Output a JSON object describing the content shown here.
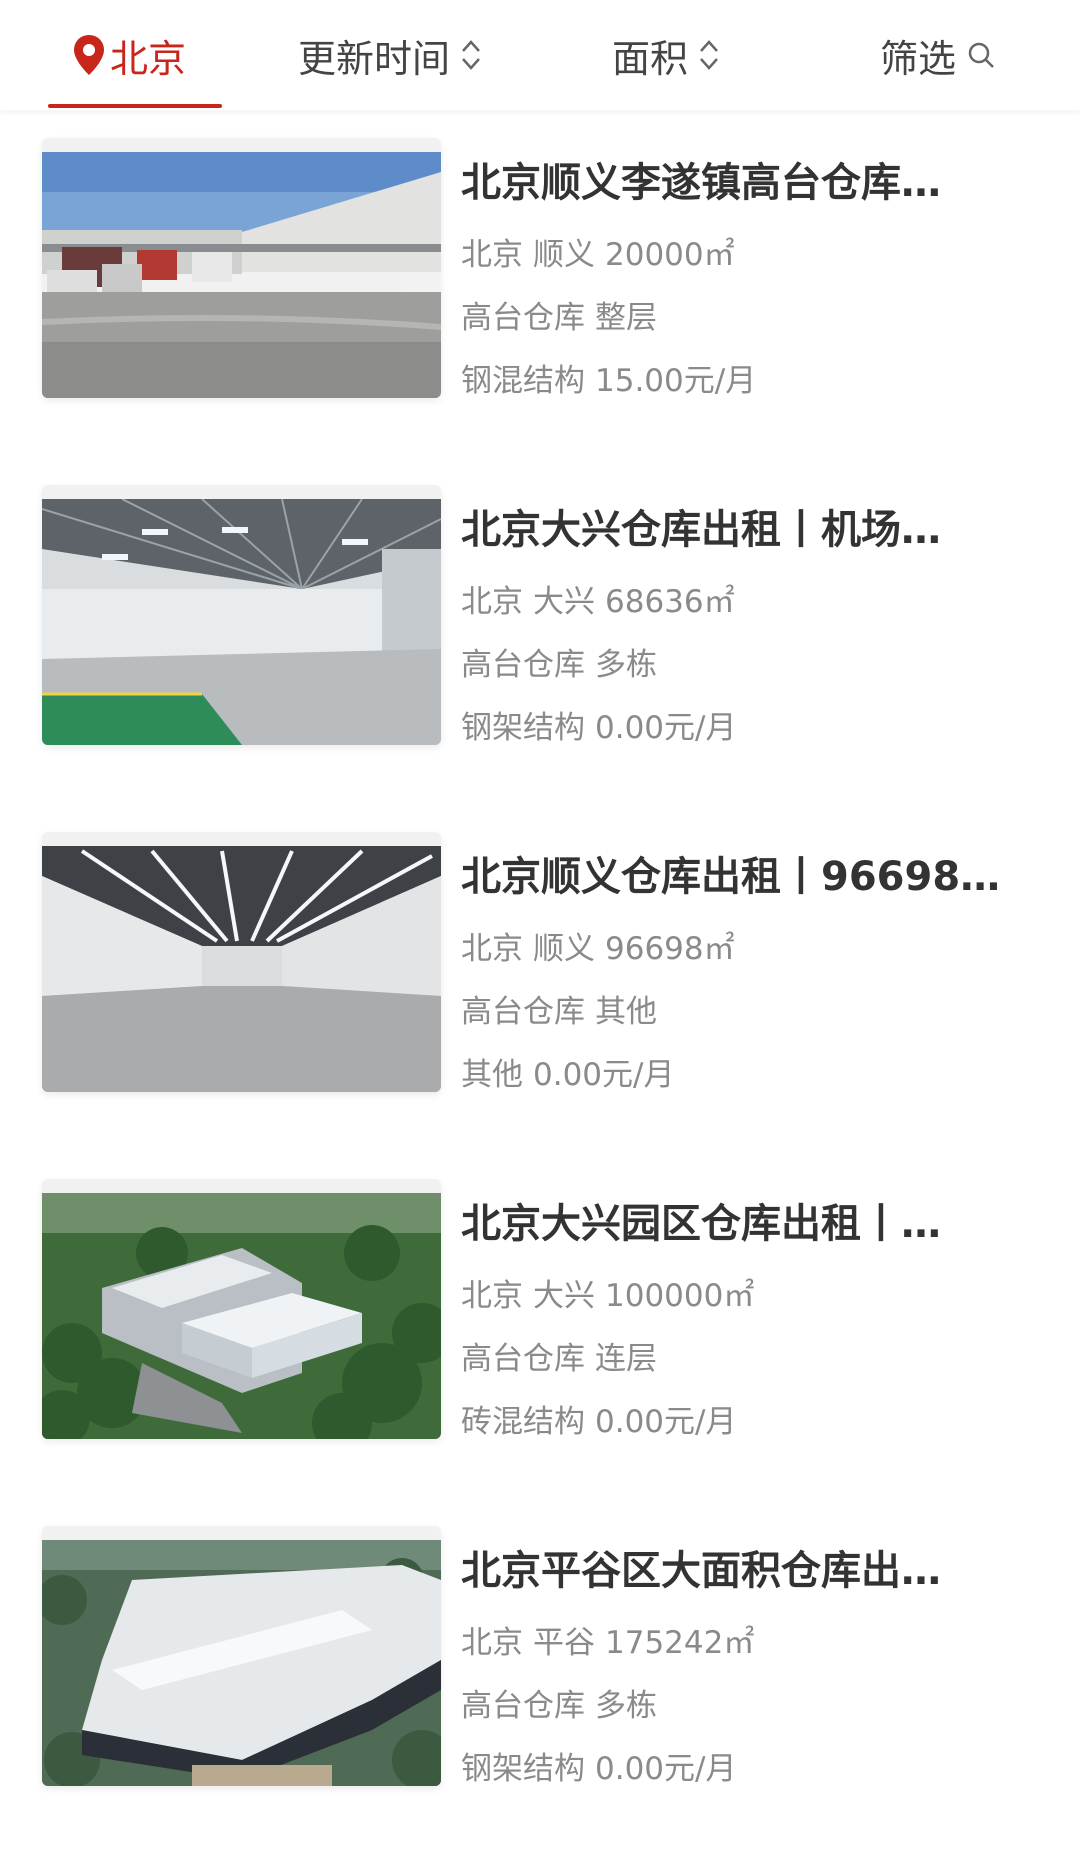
{
  "header": {
    "location_label": "北京",
    "update_time_label": "更新时间",
    "area_label": "面积",
    "filter_label": "筛选",
    "accent_color": "#c8261b",
    "icons": {
      "location": "map-pin-icon",
      "sort": "sort-updown-icon",
      "search": "search-icon"
    }
  },
  "listings": [
    {
      "title": "北京顺义李遂镇高台仓库…",
      "city": "北京",
      "district": "顺义",
      "area": "20000㎡",
      "type": "高台仓库",
      "floor": "整层",
      "structure": "钢混结构",
      "price": "15.00元/月",
      "image": "warehouse-yard-trucks"
    },
    {
      "title": "北京大兴仓库出租丨机场…",
      "city": "北京",
      "district": "大兴",
      "area": "68636㎡",
      "type": "高台仓库",
      "floor": "多栋",
      "structure": "钢架结构",
      "price": "0.00元/月",
      "image": "warehouse-interior-steel-roof"
    },
    {
      "title": "北京顺义仓库出租丨96698…",
      "city": "北京",
      "district": "顺义",
      "area": "96698㎡",
      "type": "高台仓库",
      "floor": "其他",
      "structure": "其他",
      "price": "0.00元/月",
      "image": "warehouse-interior-lit"
    },
    {
      "title": "北京大兴园区仓库出租丨…",
      "city": "北京",
      "district": "大兴",
      "area": "100000㎡",
      "type": "高台仓库",
      "floor": "连层",
      "structure": "砖混结构",
      "price": "0.00元/月",
      "image": "logistics-park-aerial"
    },
    {
      "title": "北京平谷区大面积仓库出…",
      "city": "北京",
      "district": "平谷",
      "area": "175242㎡",
      "type": "高台仓库",
      "floor": "多栋",
      "structure": "钢架结构",
      "price": "0.00元/月",
      "image": "warehouse-complex-aerial"
    }
  ]
}
